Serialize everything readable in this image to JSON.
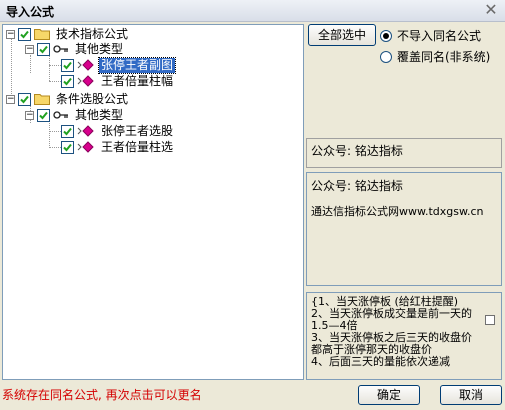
{
  "window": {
    "title": "导入公式",
    "close_glyph": "✕"
  },
  "tree": {
    "nodes": [
      {
        "label": "技术指标公式"
      },
      {
        "label": "其他类型"
      },
      {
        "label": "张停王者副图"
      },
      {
        "label": "王者倍量柱幅"
      },
      {
        "label": "条件选股公式"
      },
      {
        "label": "其他类型"
      },
      {
        "label": "张停王者选股"
      },
      {
        "label": "王者倍量柱选"
      }
    ]
  },
  "actions": {
    "select_all": "全部选中"
  },
  "options": {
    "no_import": "不导入同名公式",
    "overwrite": "覆盖同名(非系统)"
  },
  "info": {
    "panel1": "公众号: 铭达指标",
    "panel2_line1": "公众号: 铭达指标",
    "panel2_line2": "通达信指标公式网www.tdxgsw.cn",
    "panel3": "{1、当天涨停板 (给红柱提醒)\n2、当天涨停板成交量是前一天的1.5—4倍\n3、当天涨停板之后三天的收盘价都高于涨停那天的收盘价\n4、后面三天的量能依次递减"
  },
  "status": "系统存在同名公式, 再次点击可以更名",
  "buttons": {
    "ok": "确定",
    "cancel": "取消"
  },
  "colors": {
    "selection": "#316ac5",
    "status_text": "#d40000",
    "leaf_icon": "#d8008c"
  }
}
